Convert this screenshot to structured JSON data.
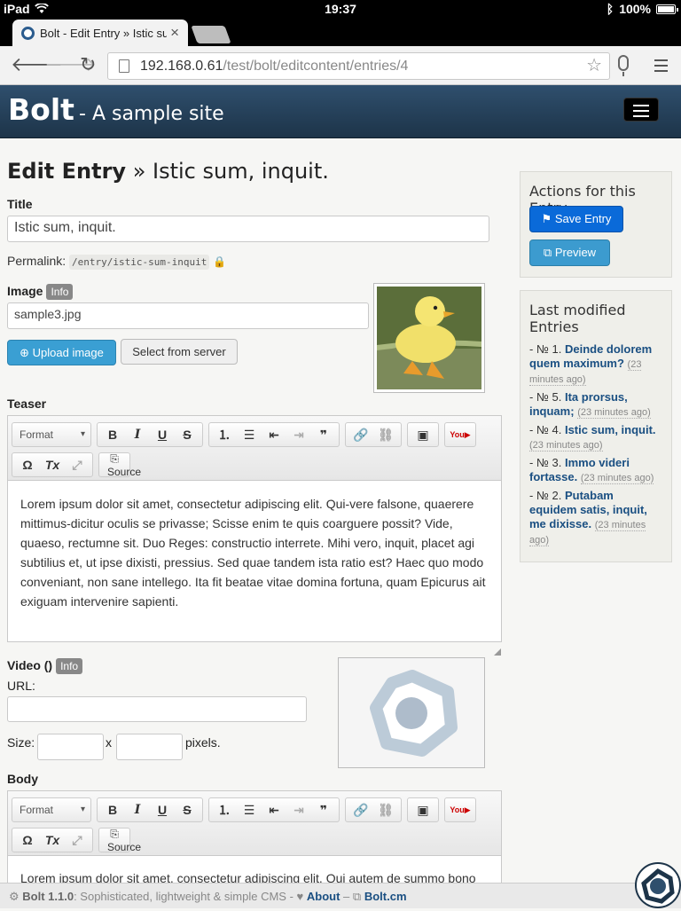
{
  "status": {
    "device": "iPad",
    "time": "19:37",
    "battery": "100%"
  },
  "browser": {
    "tab_title": "Bolt - Edit Entry » Istic sum",
    "tab_close": "×",
    "url_host": "192.168.0.61",
    "url_path": "/test/bolt/editcontent/entries/4"
  },
  "header": {
    "brand": "Bolt",
    "subtitle": "- A sample site"
  },
  "page": {
    "title_bold": "Edit Entry",
    "title_rest": " » Istic sum, inquit."
  },
  "form": {
    "title_label": "Title",
    "title_value": "Istic sum, inquit.",
    "permalink_label": "Permalink:",
    "permalink_value": "/entry/istic-sum-inquit",
    "image_label": "Image",
    "info_badge": "Info",
    "image_value": "sample3.jpg",
    "upload_label": "Upload image",
    "select_label": "Select from server",
    "teaser_label": "Teaser",
    "teaser_text": "Lorem ipsum dolor sit amet, consectetur adipiscing elit. Qui-vere falsone, quaerere mittimus-dicitur oculis se privasse; Scisse enim te quis coarguere possit? Vide, quaeso, rectumne sit. Duo Reges: constructio interrete. Mihi vero, inquit, placet agi subtilius et, ut ipse dixisti, pressius. Sed quae tandem ista ratio est? Haec quo modo conveniant, non sane intellego. Ita fit beatae vitae domina fortuna, quam Epicurus ait exiguam intervenire sapienti.",
    "video_label": "Video ()",
    "url_label": "URL:",
    "size_label": "Size:",
    "size_x": "x",
    "pixels_label": "pixels.",
    "body_label": "Body",
    "body_text": "Lorem ipsum dolor sit amet, consectetur adipiscing elit. Qui autem de summo bono"
  },
  "editor": {
    "format_label": "Format",
    "source_label": "Source"
  },
  "sidebar": {
    "actions_title": "Actions for this Entry",
    "save_label": "Save Entry",
    "preview_label": "Preview",
    "last_title": "Last modified Entries",
    "entries": [
      {
        "no": "- № 1.",
        "title": "Deinde dolorem quem maximum?",
        "ago": "(23 minutes ago)"
      },
      {
        "no": "- № 5.",
        "title": "Ita prorsus, inquam;",
        "ago": "(23 minutes ago)"
      },
      {
        "no": "- № 4.",
        "title": "Istic sum, inquit.",
        "ago": "(23 minutes ago)"
      },
      {
        "no": "- № 3.",
        "title": "Immo videri fortasse.",
        "ago": "(23 minutes ago)"
      },
      {
        "no": "- № 2.",
        "title": "Putabam equidem satis, inquit, me dixisse.",
        "ago": "(23 minutes ago)"
      }
    ]
  },
  "footer": {
    "version": "Bolt 1.1.0",
    "tagline": ": Sophisticated, lightweight & simple CMS -",
    "about": "About",
    "dash": "–",
    "site": "Bolt.cm"
  },
  "colors": {
    "header_bg": "#2f4f6d",
    "save_button": "#0a6ad9",
    "upload_button": "#3a9fd3",
    "link": "#1a4f82"
  }
}
